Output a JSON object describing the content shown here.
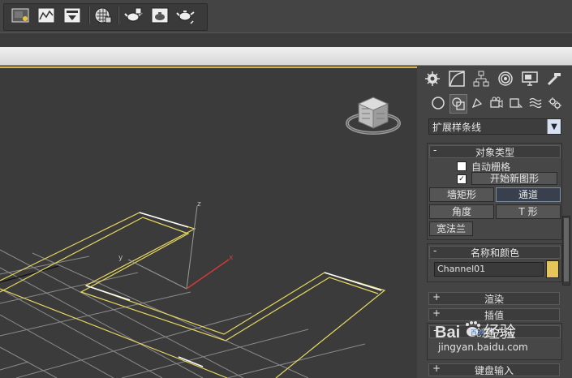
{
  "toolbar": {
    "buttons": [
      {
        "name": "render-setup-icon"
      },
      {
        "name": "rendered-frame-window-icon"
      },
      {
        "name": "render-production-icon"
      },
      {
        "name": "material-editor-icon"
      },
      {
        "name": "teapot-iterative-icon"
      },
      {
        "name": "teapot-render-icon"
      },
      {
        "name": "teapot-activeshade-icon"
      }
    ]
  },
  "viewport": {
    "axis_labels": {
      "z": "z",
      "y": "y",
      "x": "x"
    },
    "colors": {
      "grid": "#8a8a8a",
      "shape": "#e8d860",
      "x_axis": "#d23a3a"
    }
  },
  "panel": {
    "tabs": [
      "create-tab",
      "modify-tab",
      "hierarchy-tab",
      "motion-tab",
      "display-tab",
      "utilities-tab"
    ],
    "sub_icons": [
      "geometry-icon",
      "shapes-icon",
      "lights-icon",
      "cameras-icon",
      "helpers-icon",
      "spacewarps-icon",
      "systems-icon"
    ],
    "dropdown": {
      "value": "扩展样条线"
    },
    "object_type": {
      "sign": "-",
      "title": "对象类型",
      "auto_grid": {
        "label": "自动栅格",
        "checked": false
      },
      "start_new_shape": {
        "label": "开始新图形",
        "checked": true
      },
      "buttons": [
        "墙矩形",
        "通道",
        "角度",
        "T 形",
        "宽法兰"
      ]
    },
    "name_color": {
      "sign": "-",
      "title": "名称和颜色",
      "name_value": "Channel01",
      "swatch_color": "#e6c65a"
    },
    "render": {
      "sign": "+",
      "title": "渲染"
    },
    "interpolation": {
      "sign": "+",
      "title": "插值"
    },
    "creation_method": {
      "sign": "-",
      "title": "创建方法"
    },
    "keyboard_entry": {
      "sign": "+",
      "title": "键盘输入"
    }
  },
  "watermark": {
    "brand": "Bai",
    "brand_du": "百度",
    "suffix": "经验",
    "url": "jingyan.baidu.com"
  }
}
